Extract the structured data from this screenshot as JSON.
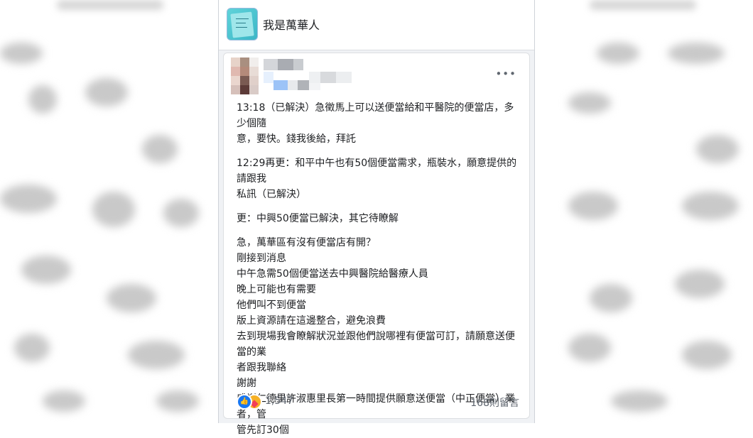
{
  "group": {
    "name": "我是萬華人"
  },
  "post": {
    "more_label": "•••",
    "paragraphs": [
      {
        "lines": [
          "13:18（已解決）急徵馬上可以送便當給和平醫院的便當店，多少個隨",
          "意，要快。錢我後給，拜託"
        ]
      },
      {
        "lines": [
          "12:29再更：和平中午也有50個便當需求，瓶裝水，願意提供的請跟我",
          "私訊（已解決）"
        ]
      },
      {
        "lines": [
          "更：中興50便當已解決，其它待瞭解"
        ]
      },
      {
        "lines": [
          "急，萬華區有沒有便當店有開？",
          "剛接到消息",
          "中午急需50個便當送去中興醫院給醫療人員",
          "晚上可能也有需要",
          "他們叫不到便當",
          "版上資源請在這邊整合，避免浪費",
          "去到現場我會瞭解狀況並跟他們說哪裡有便當可訂，請願意送便當的業",
          "者跟我聯絡",
          "謝謝",
          "感謝仁德里許淑惠里長第一時間提供願意送便當（中正便當）業者，管",
          "管先訂30個"
        ]
      }
    ],
    "reactions": {
      "count": "1,547",
      "like_color": "#1877f2",
      "care_color": "#f7b125"
    },
    "comments": "168則留言"
  }
}
